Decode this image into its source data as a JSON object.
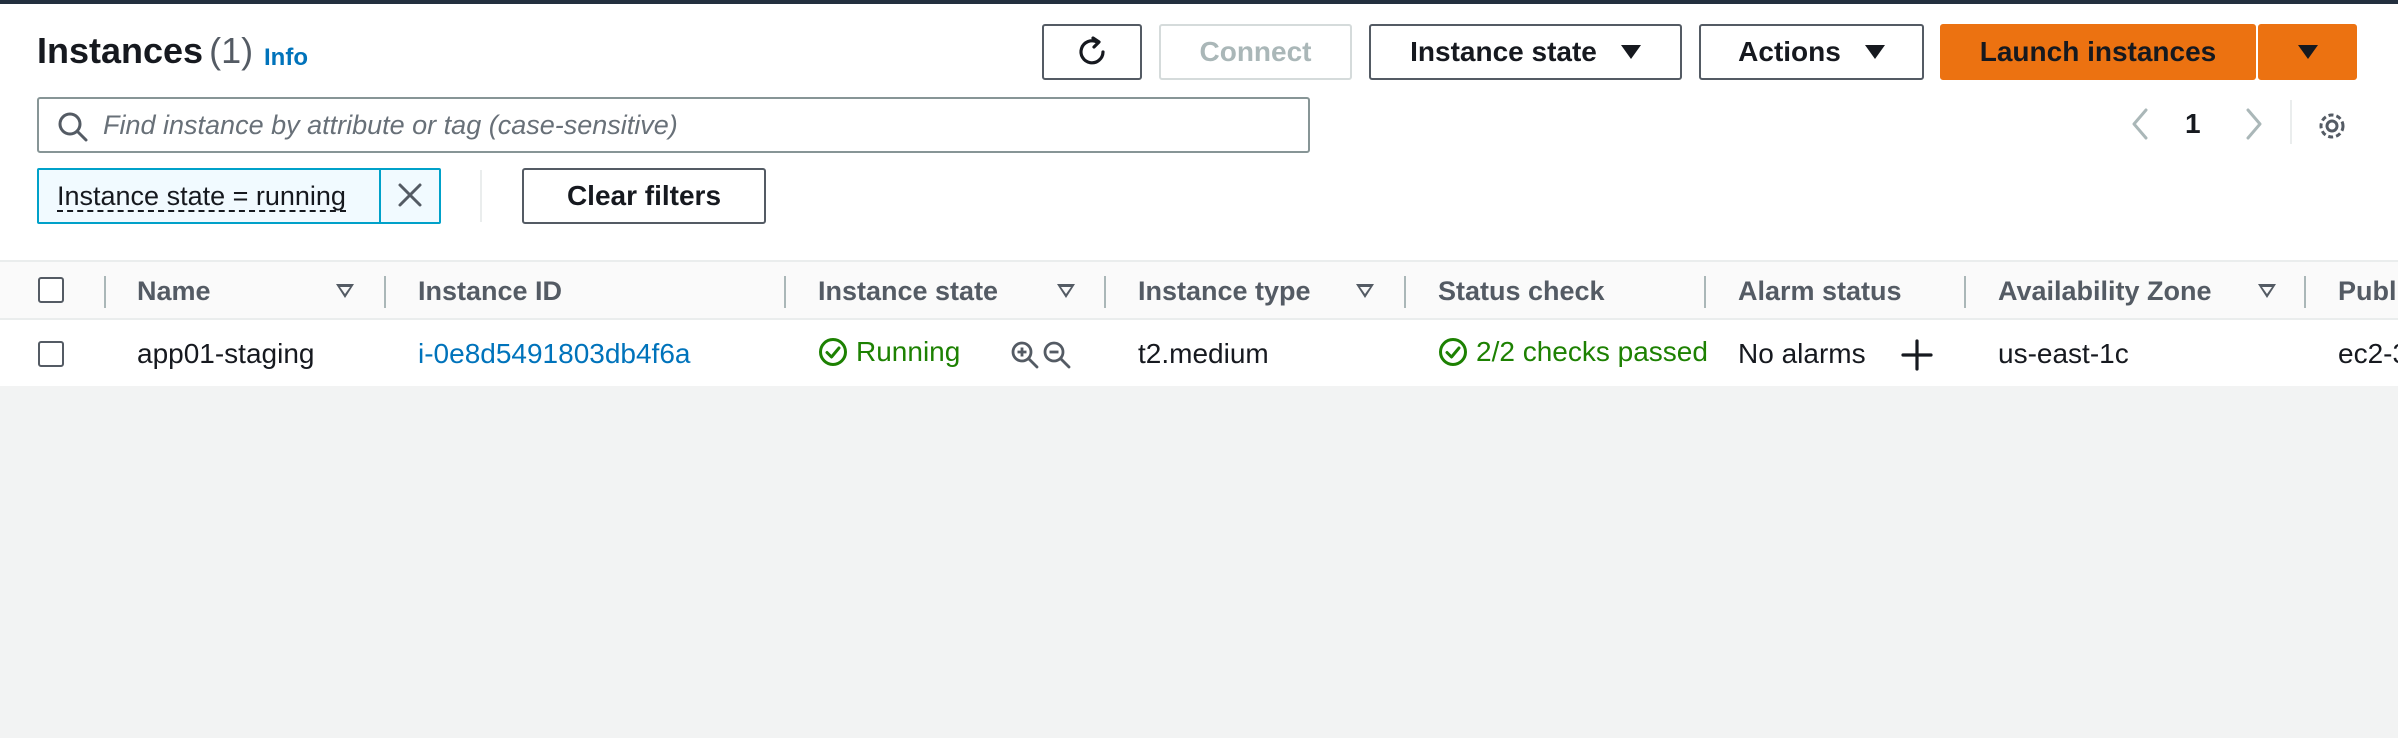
{
  "header": {
    "title": "Instances",
    "count": "(1)",
    "info": "Info"
  },
  "toolbar": {
    "connect": "Connect",
    "instance_state": "Instance state",
    "actions": "Actions",
    "launch": "Launch instances"
  },
  "search": {
    "placeholder": "Find instance by attribute or tag (case-sensitive)",
    "value": ""
  },
  "pagination": {
    "current": "1"
  },
  "filters": {
    "token": "Instance state = running",
    "clear": "Clear filters"
  },
  "table": {
    "columns": [
      "Name",
      "Instance ID",
      "Instance state",
      "Instance type",
      "Status check",
      "Alarm status",
      "Availability Zone",
      "Publ"
    ],
    "rows": [
      {
        "name": "app01-staging",
        "instance_id": "i-0e8d5491803db4f6a",
        "state": "Running",
        "type": "t2.medium",
        "status_check": "2/2 checks passed",
        "alarm": "No alarms",
        "az": "us-east-1c",
        "public": "ec2-3"
      }
    ]
  },
  "colors": {
    "accent": "#ec7211",
    "link": "#0073bb",
    "success": "#1d8102",
    "topbar": "#232f3e"
  },
  "icons": [
    "refresh-icon",
    "caret-down-icon",
    "search-icon",
    "chevron-left-icon",
    "chevron-right-icon",
    "gear-icon",
    "close-icon",
    "sort-icon",
    "check-circle-icon",
    "zoom-in-icon",
    "zoom-out-icon",
    "plus-icon"
  ]
}
